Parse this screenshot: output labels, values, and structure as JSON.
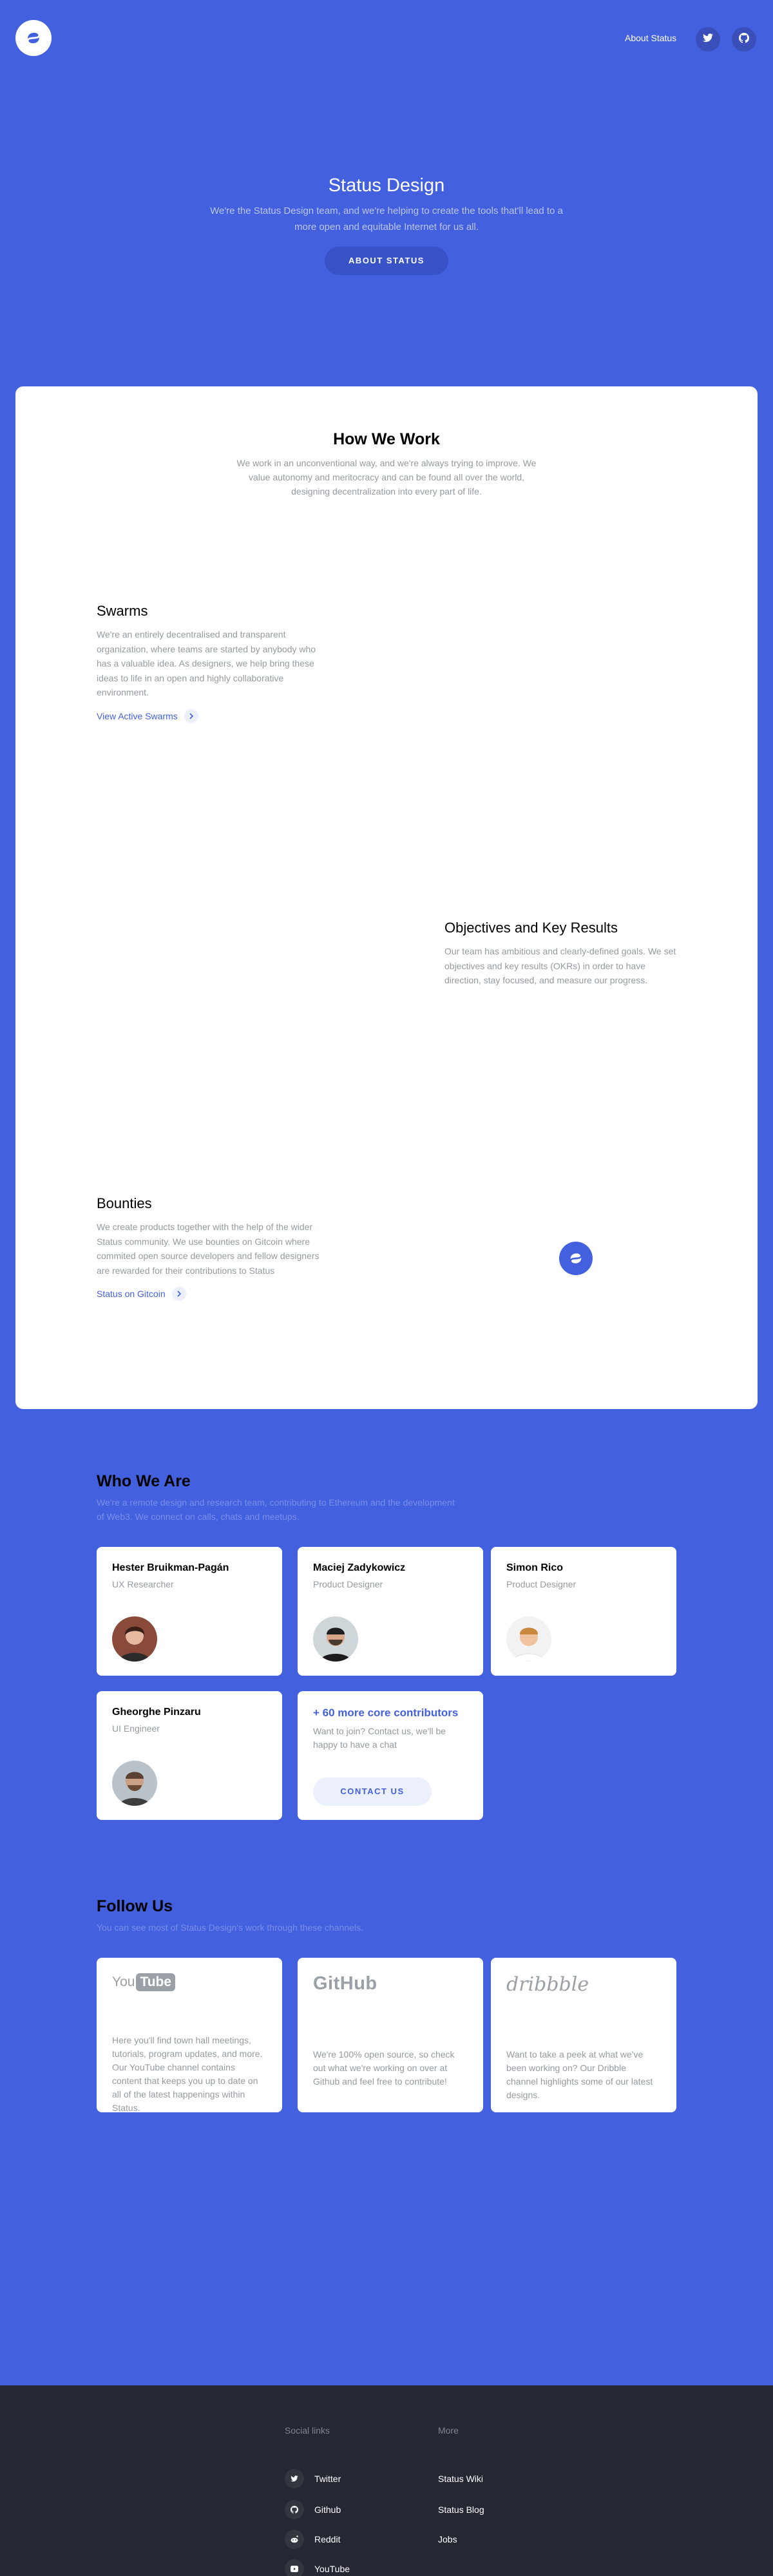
{
  "header": {
    "nav_link": "About Status",
    "icons": [
      "twitter-icon",
      "github-icon"
    ]
  },
  "hero": {
    "title": "Status Design",
    "subtitle": "We're the Status Design team, and we're helping to create the tools that'll lead to a more open and equitable Internet for us all.",
    "button": "ABOUT STATUS"
  },
  "how_we_work": {
    "title": "How We Work",
    "subtitle": "We work in an unconventional way, and we're always trying to improve. We value autonomy and meritocracy and can be found all over the world, designing decentralization into every part of life.",
    "features": [
      {
        "title": "Swarms",
        "text": "We're an entirely decentralised and transparent organization, where teams are started by anybody who has a valuable idea. As designers, we help bring these ideas to life in an open and highly collaborative environment.",
        "link": "View Active Swarms"
      },
      {
        "title": "Objectives and Key Results",
        "text": "Our team has ambitious and clearly-defined goals. We set objectives and key results (OKRs) in order to have direction, stay focused, and measure our progress.",
        "link": ""
      },
      {
        "title": "Bounties",
        "text": "We create products together with the help of the wider Status community. We use bounties on Gitcoin where commited open source developers and fellow designers are rewarded for their contributions to Status",
        "link": "Status on Gitcoin"
      }
    ]
  },
  "who_we_are": {
    "title": "Who We Are",
    "subtitle": "We're a remote design and research team, contributing to Ethereum and the development of Web3. We connect on calls, chats and meetups.",
    "people": [
      {
        "name": "Hester Bruikman-Pagán",
        "role": "UX Researcher"
      },
      {
        "name": "Maciej Zadykowicz",
        "role": "Product Designer"
      },
      {
        "name": "Simon Rico",
        "role": "Product Designer"
      },
      {
        "name": "Gheorghe Pinzaru",
        "role": "UI Engineer"
      }
    ],
    "more": {
      "title": "+ 60 more core contributors",
      "text": "Want to join? Contact us, we'll be happy to have a chat",
      "button": "CONTACT US"
    }
  },
  "follow_us": {
    "title": "Follow Us",
    "subtitle": "You can see most of Status Design's work through these channels.",
    "channels": [
      {
        "logo_a": "You",
        "logo_b": "Tube",
        "text": "Here you'll find town hall meetings, tutorials, program updates, and more. Our YouTube channel contains content that keeps you up to date on all of the latest happenings within Status."
      },
      {
        "logo": "GitHub",
        "text": "We're 100% open source, so check out what we're working on over at Github and feel free to contribute!"
      },
      {
        "logo": "dribbble",
        "text": "Want to take a peek at what we've been working on? Our Dribble channel highlights some of our latest designs."
      }
    ]
  },
  "footer": {
    "social_title": "Social links",
    "more_title": "More",
    "social": [
      "Twitter",
      "Github",
      "Reddit",
      "YouTube"
    ],
    "more": [
      "Status Wiki",
      "Status Blog",
      "Jobs"
    ]
  },
  "colors": {
    "brand": "#4360df",
    "footer_bg": "#252833",
    "muted": "#939ba1"
  }
}
